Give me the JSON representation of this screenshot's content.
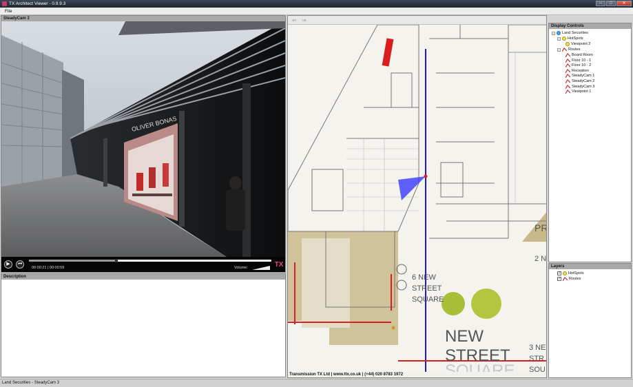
{
  "window": {
    "title": "TX Architect Viewer - 0.9.9.3"
  },
  "menu": {
    "file": "File"
  },
  "video": {
    "header": "SteadyCam 3",
    "time": "00:00:21 | 00:00:59",
    "volume_label": "Volume:",
    "progress": 0.36,
    "logo": "TX"
  },
  "description": {
    "header": "Description"
  },
  "map": {
    "footer": "Transmission TX Ltd | www.ttx.co.uk | (+44) 020 8783 1972",
    "labels": {
      "six_new": "6 NEW",
      "street": "STREET",
      "square": "SQUARE",
      "new": "NEW",
      "street_big": "STREET",
      "square_big": "SQUARE",
      "three_ne": "3 NE",
      "str": "STR",
      "squ": "SQU",
      "two_n": "2 N",
      "pr": "PR"
    }
  },
  "display_controls": {
    "header": "Display Controls",
    "root": "Land Securities",
    "hotspots": "HotSpots",
    "viewpoint2": "Viewpoint 2",
    "routes": "Routes",
    "route_items": [
      "Board Room",
      "Floor 10 - 1",
      "Floor 10 - 2",
      "Reception",
      "SteadyCam 1",
      "SteadyCam 2",
      "SteadyCam 3",
      "Viewpoint 1"
    ]
  },
  "layers": {
    "header": "Layers",
    "items": [
      "HotSpots",
      "Routes"
    ]
  },
  "status": "Land Securities - SteadyCam 3",
  "colors": {
    "route_red": "#d81e1e",
    "route_blue": "#1a1acc",
    "accent_pink": "#e04a8a"
  }
}
